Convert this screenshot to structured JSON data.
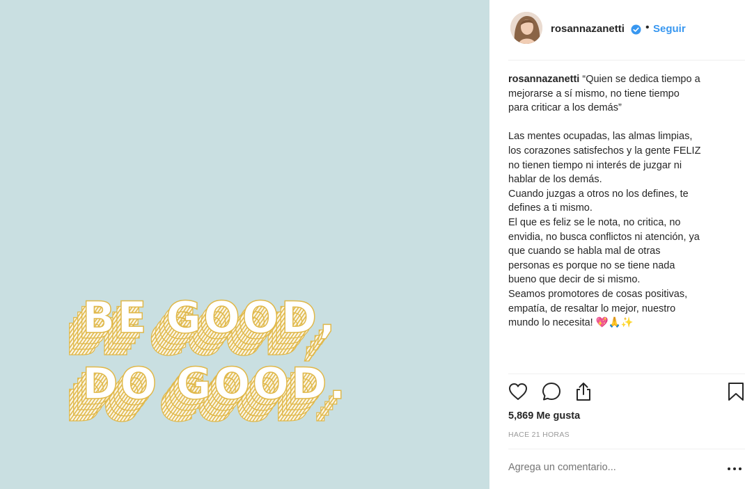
{
  "post_image": {
    "art_line1": "BE GOOD,",
    "art_line2": "DO GOOD.",
    "background_color": "#c9dfe1",
    "accent_color": "#e0b84a"
  },
  "header": {
    "username": "rosannazanetti",
    "verified_icon": "verified-badge-icon",
    "separator": "•",
    "follow_label": "Seguir"
  },
  "caption": {
    "username": "rosannazanetti",
    "lines": [
      "“Quien se dedica tiempo a",
      "mejorarse a sí mismo, no tiene tiempo",
      "para criticar a los demás”",
      "",
      "Las mentes ocupadas, las almas limpias,",
      "los corazones satisfechos y la gente FELIZ",
      "no tienen tiempo ni interés de juzgar ni",
      "hablar de los demás.",
      "Cuando juzgas a otros no los defines, te",
      "defines a ti mismo.",
      "El que es feliz se le nota, no critica, no",
      "envidia, no busca conflictos ni atención, ya",
      "que cuando se habla mal de otras",
      "personas es porque no se tiene nada",
      "bueno que decir de si mismo.",
      "Seamos promotores de cosas positivas,",
      "empatía, de resaltar lo mejor, nuestro",
      "mundo lo necesita! 💖🙏✨"
    ]
  },
  "actions": {
    "like_icon": "heart-icon",
    "comment_icon": "comment-bubble-icon",
    "share_icon": "share-icon",
    "save_icon": "bookmark-icon"
  },
  "likes_text": "5,869 Me gusta",
  "timestamp": "HACE 21 HORAS",
  "comment_box": {
    "placeholder": "Agrega un comentario...",
    "more_icon": "more-options-icon"
  },
  "colors": {
    "link": "#3897f0",
    "text": "#262626",
    "muted": "#999999",
    "divider": "#efefef"
  }
}
